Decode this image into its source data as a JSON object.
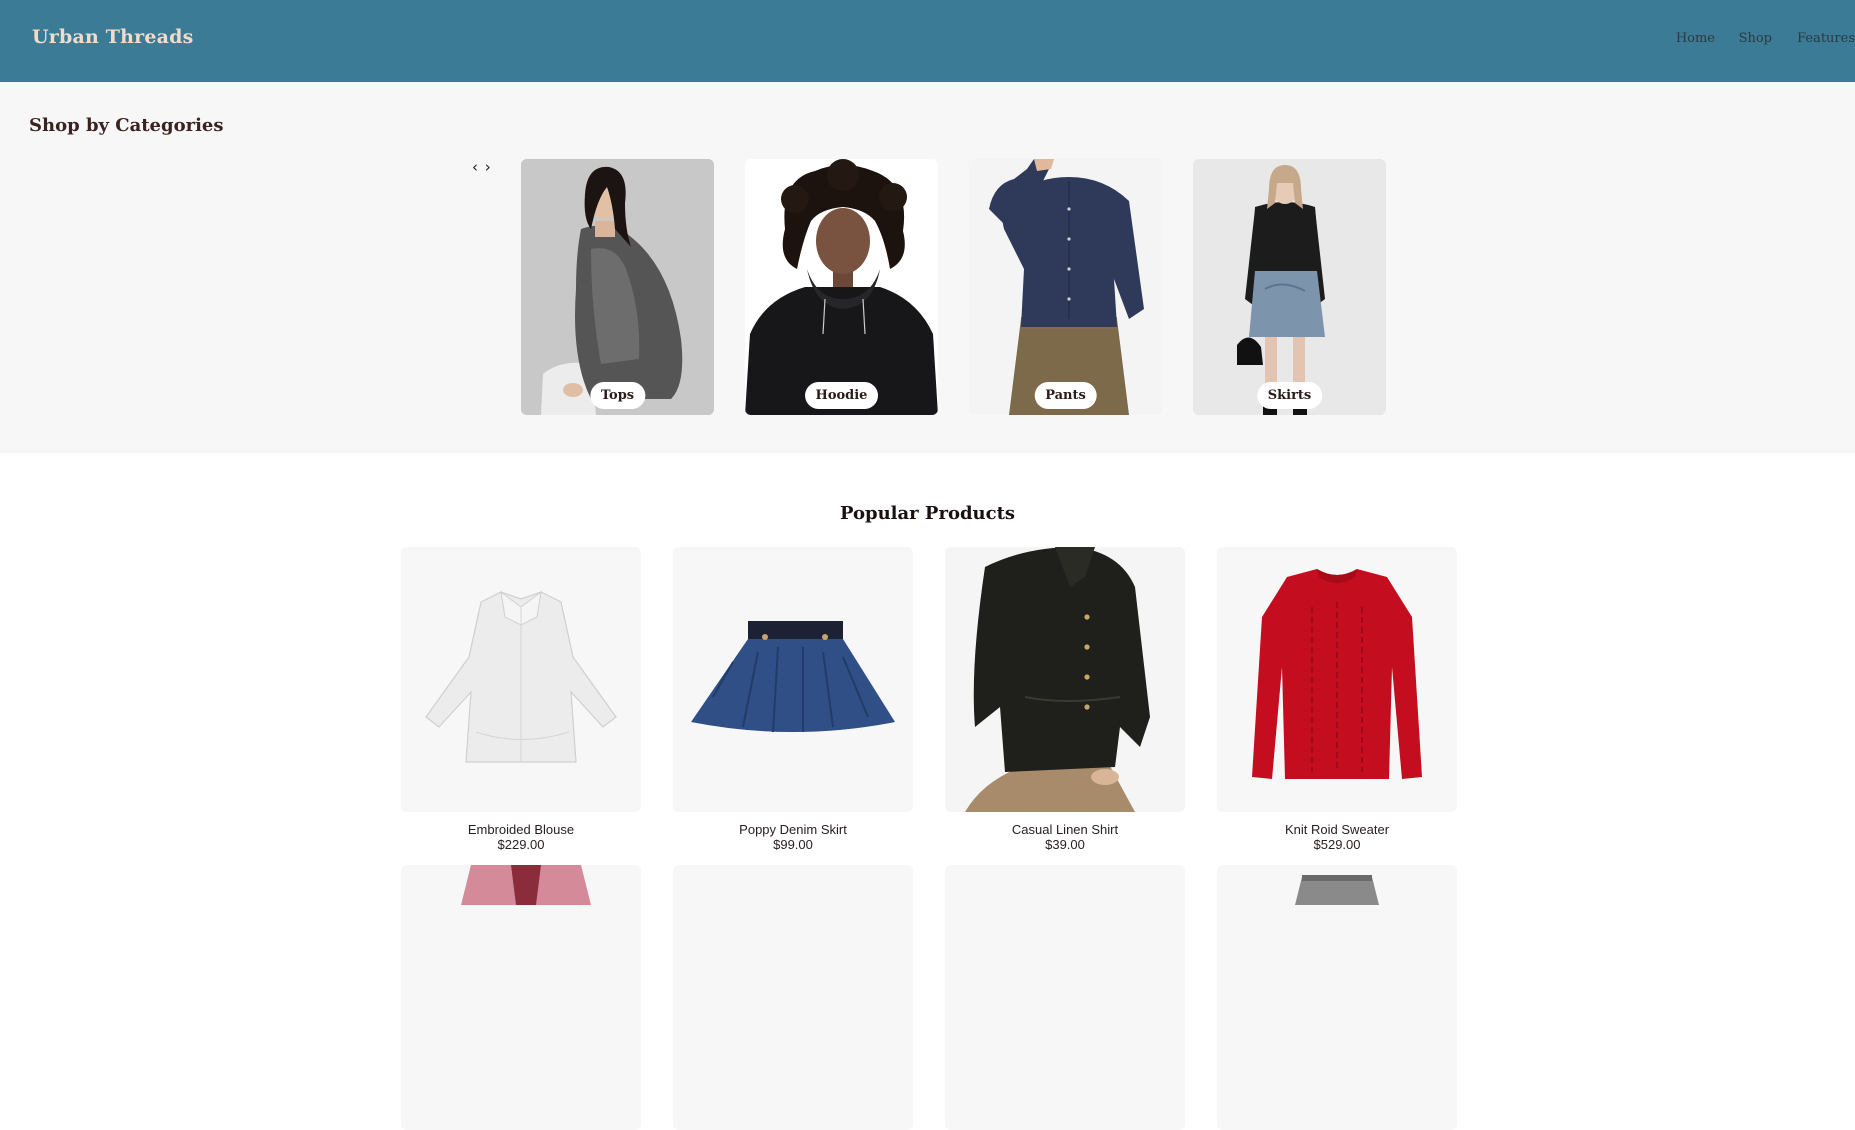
{
  "header": {
    "brand": "Urban Threads",
    "nav": [
      "Home",
      "Shop",
      "Features"
    ],
    "color": "#3c7b96"
  },
  "categories": {
    "title": "Shop by Categories",
    "prev_icon": "chevron-left-icon",
    "next_icon": "chevron-right-icon",
    "prev_glyph": "‹",
    "next_glyph": "›",
    "items": [
      {
        "label": "Tops"
      },
      {
        "label": "Hoodie"
      },
      {
        "label": "Pants"
      },
      {
        "label": "Skirts"
      }
    ]
  },
  "popular": {
    "title": "Popular Products",
    "products": [
      {
        "name": "Embroided Blouse",
        "price": "$229.00"
      },
      {
        "name": "Poppy Denim Skirt",
        "price": "$99.00"
      },
      {
        "name": "Casual Linen Shirt",
        "price": "$39.00"
      },
      {
        "name": "Knit Roid Sweater",
        "price": "$529.00"
      }
    ]
  }
}
